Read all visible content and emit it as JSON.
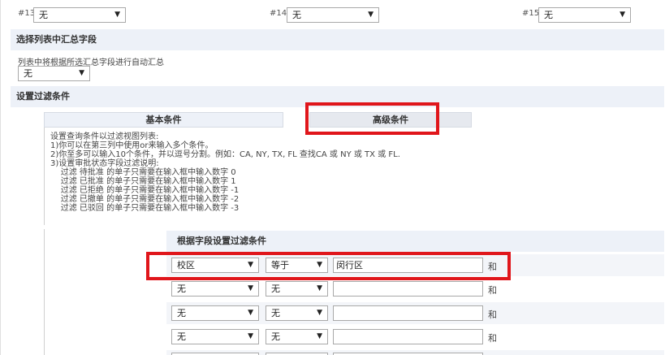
{
  "top_selects": [
    {
      "num": "#13",
      "value": "无"
    },
    {
      "num": "#14",
      "value": "无"
    },
    {
      "num": "#15",
      "value": "无"
    }
  ],
  "summary_section": {
    "title": "选择列表中汇总字段",
    "note": "列表中将根据所选汇总字段进行自动汇总",
    "select_value": "无"
  },
  "filter_section": {
    "title": "设置过滤条件",
    "tabs": {
      "basic": "基本条件",
      "advanced": "高级条件"
    },
    "instructions": [
      "设置查询条件以过滤视图列表:",
      "1)你可以在第三列中使用or来输入多个条件。",
      "2)你至多可以输入10个条件，并以逗号分割。例如：CA, NY, TX, FL 查找CA 或 NY 或 TX 或 FL.",
      "3)设置审批状态字段过滤说明:",
      "    过滤 待批准 的单子只需要在输入框中输入数字 0",
      "    过滤 已批准 的单子只需要在输入框中输入数字 1",
      "    过滤 已拒绝 的单子只需要在输入框中输入数字 -1",
      "    过滤 已撤单 的单子只需要在输入框中输入数字 -2",
      "    过滤 已驳回 的单子只需要在输入框中输入数字 -3"
    ],
    "field_header": "根据字段设置过滤条件",
    "rows": [
      {
        "field": "校区",
        "operator": "等于",
        "value": "闵行区",
        "conj": "和"
      },
      {
        "field": "无",
        "operator": "无",
        "value": "",
        "conj": "和"
      },
      {
        "field": "无",
        "operator": "无",
        "value": "",
        "conj": "和"
      },
      {
        "field": "无",
        "operator": "无",
        "value": "",
        "conj": "和"
      },
      {
        "field": "",
        "operator": "",
        "value": "",
        "conj": ""
      }
    ]
  },
  "colors": {
    "highlight": "#e0161b",
    "section_bg": "#edf1f8"
  },
  "icons": {
    "dropdown": "triangle-down-icon"
  }
}
